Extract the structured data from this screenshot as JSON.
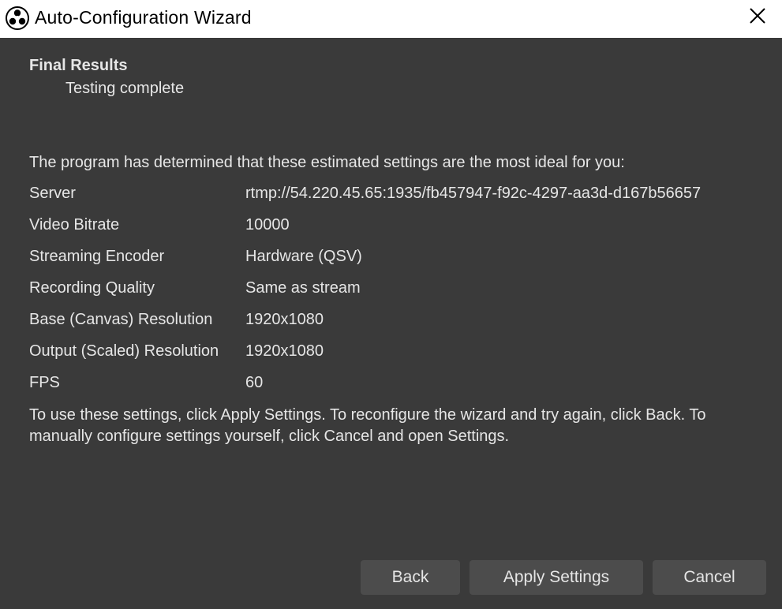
{
  "window": {
    "title": "Auto-Configuration Wizard",
    "icon": "obs-logo-icon",
    "close_icon": "close-icon"
  },
  "page": {
    "title": "Final Results",
    "subtitle": "Testing complete",
    "intro": "The program has determined that these estimated settings are the most ideal for you:",
    "outro": "To use these settings, click Apply Settings. To reconfigure the wizard and try again, click Back. To manually configure settings yourself, click Cancel and open Settings."
  },
  "results": [
    {
      "label": "Server",
      "value": "rtmp://54.220.45.65:1935/fb457947-f92c-4297-aa3d-d167b56657"
    },
    {
      "label": "Video Bitrate",
      "value": "10000"
    },
    {
      "label": "Streaming Encoder",
      "value": "Hardware (QSV)"
    },
    {
      "label": "Recording Quality",
      "value": "Same as stream"
    },
    {
      "label": "Base (Canvas) Resolution",
      "value": "1920x1080"
    },
    {
      "label": "Output (Scaled) Resolution",
      "value": "1920x1080"
    },
    {
      "label": "FPS",
      "value": "60"
    }
  ],
  "buttons": {
    "back": "Back",
    "apply": "Apply Settings",
    "cancel": "Cancel"
  },
  "colors": {
    "background": "#3a3a3a",
    "titlebar": "#ffffff",
    "text": "#e6e6e6",
    "button": "#4c4c4c"
  }
}
